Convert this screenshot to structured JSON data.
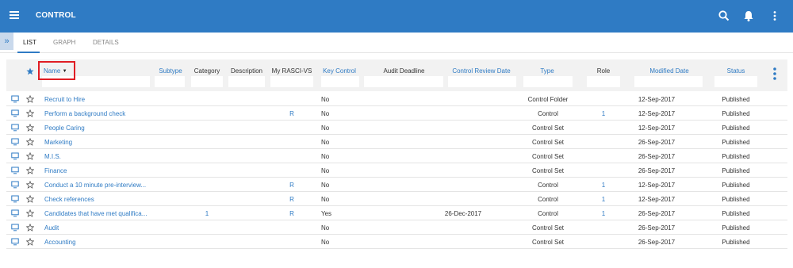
{
  "app": {
    "title": "CONTROL"
  },
  "topbar_icons": [
    "menu-icon",
    "search-icon",
    "bell-icon",
    "more-vert-icon"
  ],
  "tabs": [
    {
      "label": "LIST",
      "active": true
    },
    {
      "label": "GRAPH",
      "active": false
    },
    {
      "label": "DETAILS",
      "active": false
    }
  ],
  "columns": {
    "name": "Name",
    "subtype": "Subtype",
    "category": "Category",
    "description": "Description",
    "rasci": "My RASCI-VS",
    "key_control": "Key Control",
    "audit_deadline": "Audit Deadline",
    "review_date": "Control Review Date",
    "type": "Type",
    "role": "Role",
    "modified": "Modified Date",
    "status": "Status"
  },
  "rows": [
    {
      "name": "Recruit to Hire",
      "category": "",
      "rasci": "",
      "key_control": "No",
      "audit_deadline": "",
      "type": "Control Folder",
      "role": "",
      "modified": "12-Sep-2017",
      "status": "Published"
    },
    {
      "name": "Perform a background check",
      "category": "",
      "rasci": "R",
      "key_control": "No",
      "audit_deadline": "",
      "type": "Control",
      "role": "1",
      "modified": "12-Sep-2017",
      "status": "Published"
    },
    {
      "name": "People Caring",
      "category": "",
      "rasci": "",
      "key_control": "No",
      "audit_deadline": "",
      "type": "Control Set",
      "role": "",
      "modified": "12-Sep-2017",
      "status": "Published"
    },
    {
      "name": "Marketing",
      "category": "",
      "rasci": "",
      "key_control": "No",
      "audit_deadline": "",
      "type": "Control Set",
      "role": "",
      "modified": "26-Sep-2017",
      "status": "Published"
    },
    {
      "name": "M.I.S.",
      "category": "",
      "rasci": "",
      "key_control": "No",
      "audit_deadline": "",
      "type": "Control Set",
      "role": "",
      "modified": "26-Sep-2017",
      "status": "Published"
    },
    {
      "name": "Finance",
      "category": "",
      "rasci": "",
      "key_control": "No",
      "audit_deadline": "",
      "type": "Control Set",
      "role": "",
      "modified": "26-Sep-2017",
      "status": "Published"
    },
    {
      "name": "Conduct a 10 minute pre-interview...",
      "category": "",
      "rasci": "R",
      "key_control": "No",
      "audit_deadline": "",
      "type": "Control",
      "role": "1",
      "modified": "12-Sep-2017",
      "status": "Published"
    },
    {
      "name": "Check references",
      "category": "",
      "rasci": "R",
      "key_control": "No",
      "audit_deadline": "",
      "type": "Control",
      "role": "1",
      "modified": "12-Sep-2017",
      "status": "Published"
    },
    {
      "name": "Candidates that have met qualifica...",
      "category": "1",
      "rasci": "R",
      "key_control": "Yes",
      "audit_deadline": "26-Dec-2017",
      "type": "Control",
      "role": "1",
      "modified": "26-Sep-2017",
      "status": "Published"
    },
    {
      "name": "Audit",
      "category": "",
      "rasci": "",
      "key_control": "No",
      "audit_deadline": "",
      "type": "Control Set",
      "role": "",
      "modified": "26-Sep-2017",
      "status": "Published"
    },
    {
      "name": "Accounting",
      "category": "",
      "rasci": "",
      "key_control": "No",
      "audit_deadline": "",
      "type": "Control Set",
      "role": "",
      "modified": "26-Sep-2017",
      "status": "Published"
    }
  ],
  "colors": {
    "brand": "#2f7bc4",
    "highlight": "#e01d24",
    "header_bg": "#f2f2f2"
  }
}
